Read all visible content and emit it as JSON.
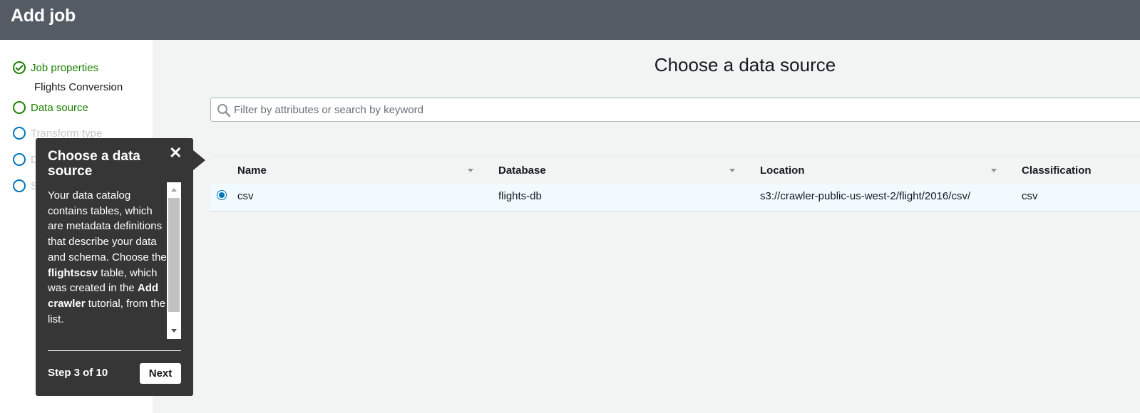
{
  "header": {
    "title": "Add job"
  },
  "sidebar": {
    "steps": [
      {
        "label": "Job properties",
        "state": "done"
      },
      {
        "label": "Data source",
        "state": "current"
      },
      {
        "label": "Transform type",
        "state": "pending"
      },
      {
        "label": "D",
        "state": "pending"
      },
      {
        "label": "S",
        "state": "pending"
      }
    ],
    "job_name": "Flights Conversion"
  },
  "main": {
    "title": "Choose a data source",
    "search": {
      "placeholder": "Filter by attributes or search by keyword",
      "value": ""
    },
    "table": {
      "columns": [
        "Name",
        "Database",
        "Location",
        "Classification"
      ],
      "rows": [
        {
          "name": "csv",
          "database": "flights-db",
          "location": "s3://crawler-public-us-west-2/flight/2016/csv/",
          "classification": "csv",
          "selected": true
        }
      ]
    }
  },
  "tooltip": {
    "title": "Choose a data source",
    "body_part1": "Your data catalog contains tables, which are metadata definitions that describe your data and schema. Choose the ",
    "body_bold1": "flightscsv",
    "body_part2": " table, which was created in the ",
    "body_bold2": "Add crawler",
    "body_part3": " tutorial, from the list.",
    "step_text": "Step 3 of 10",
    "next_label": "Next",
    "close_icon": "close-icon"
  },
  "colors": {
    "header_bg": "#545b64",
    "success": "#1d8102",
    "accent": "#0073bb",
    "tooltip_bg": "#363636",
    "selected_row": "#f1faff"
  }
}
